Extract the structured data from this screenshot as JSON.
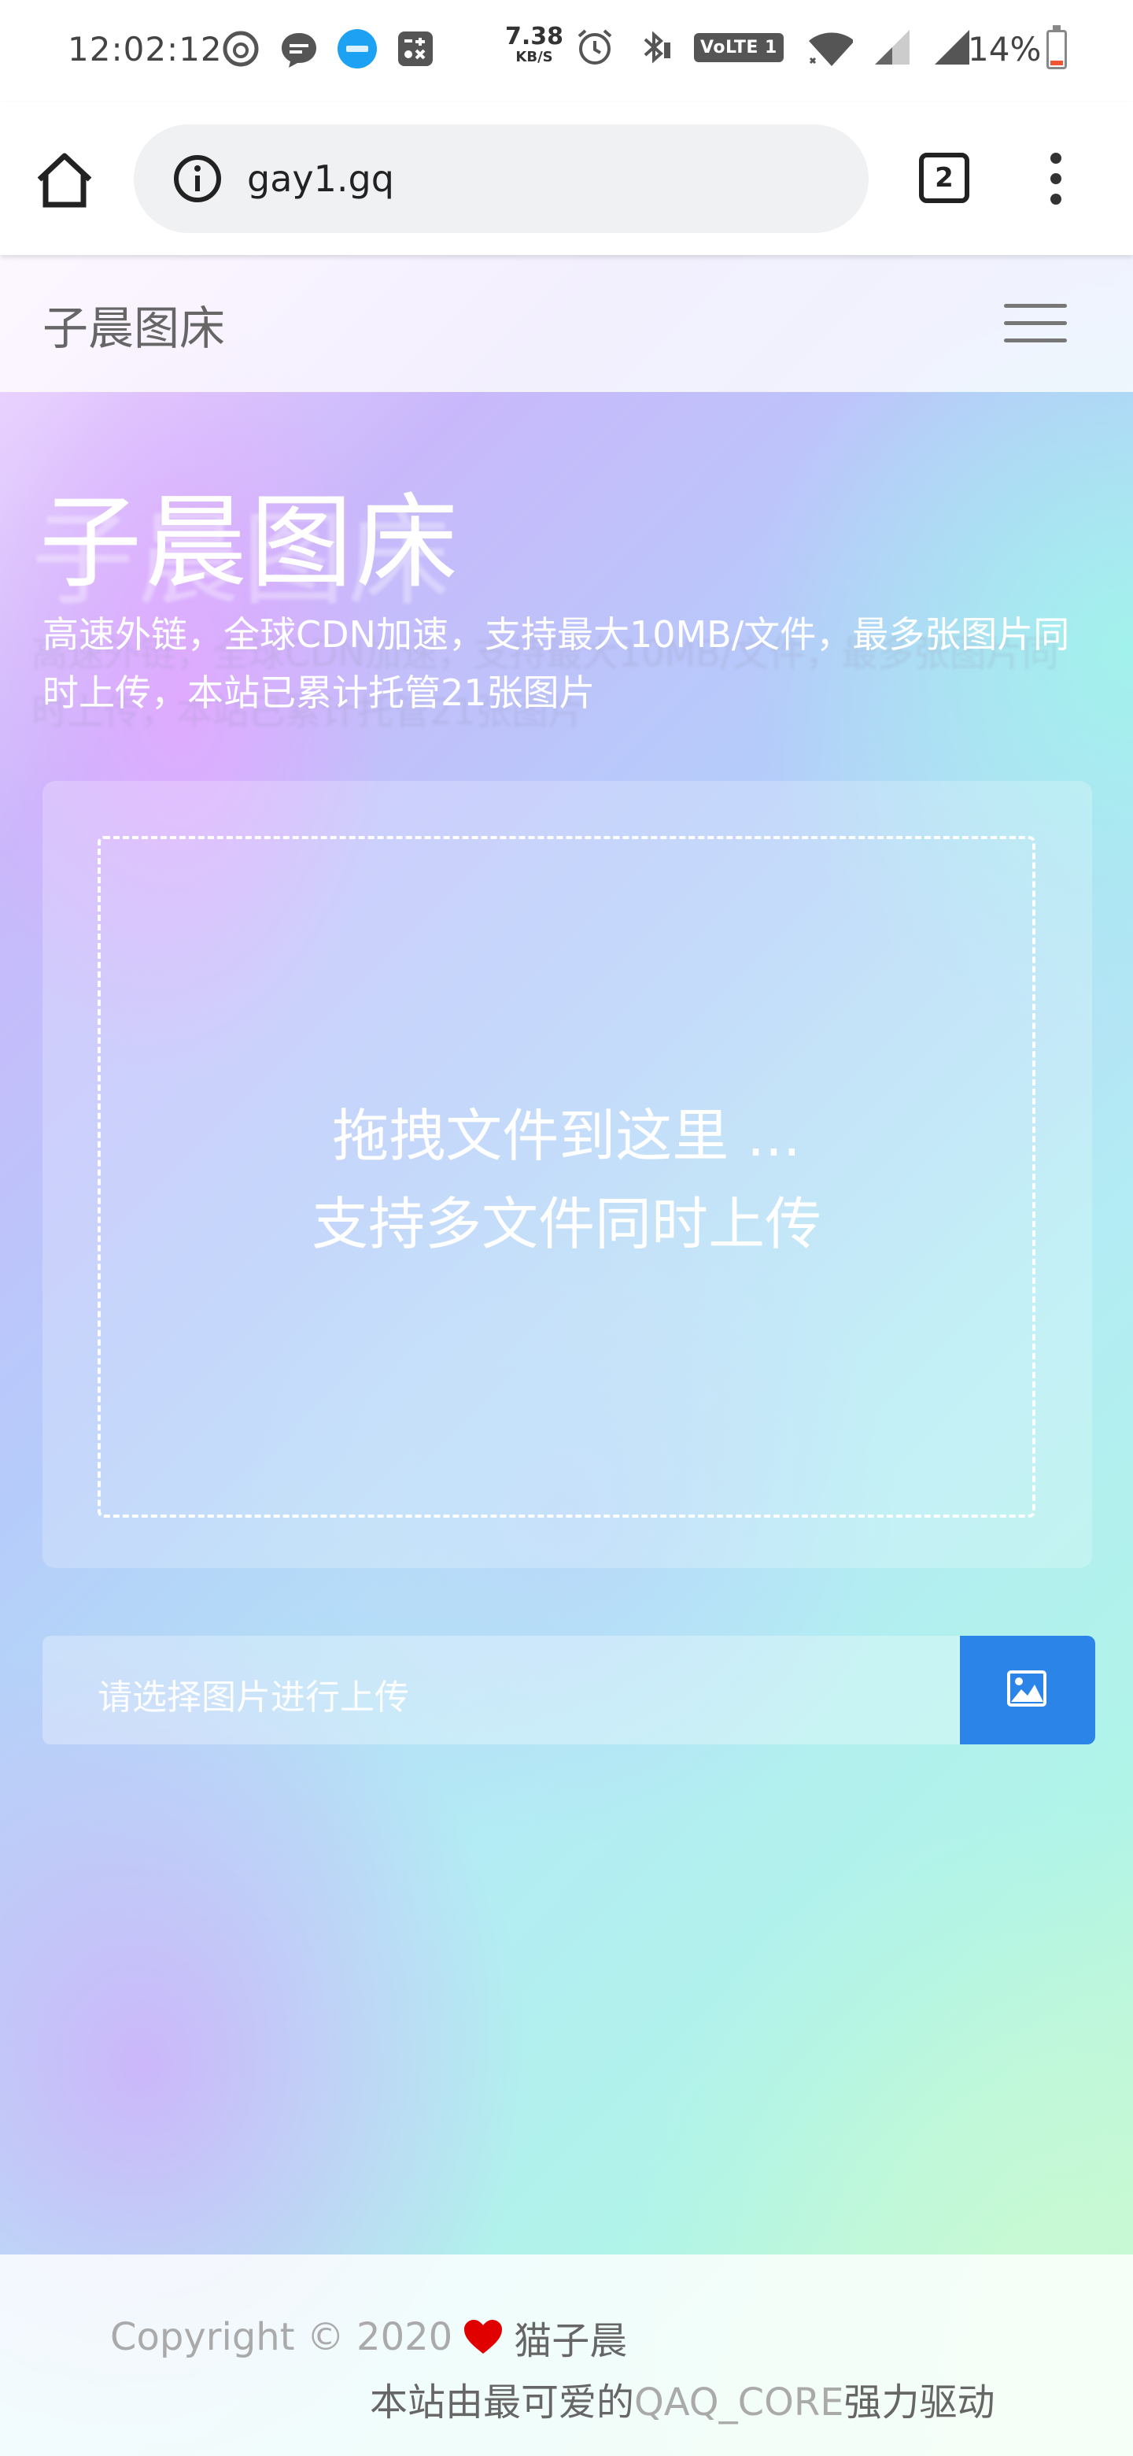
{
  "status_bar": {
    "time": "12:02:12",
    "net_speed_value": "7.38",
    "net_speed_unit": "KB/S",
    "volte_label": "VoLTE 1",
    "battery_percent": "14%",
    "battery_level": 0.14,
    "icons": [
      "netease-music-icon",
      "message-icon",
      "app-icon",
      "toolbox-icon",
      "alarm-icon",
      "bluetooth-icon",
      "wifi-icon",
      "signal-icon"
    ]
  },
  "browser": {
    "url": "gay1.gq",
    "tab_count": "2"
  },
  "navbar": {
    "brand": "子晨图床"
  },
  "hero": {
    "title": "子晨图床",
    "subtitle": "高速外链，全球CDN加速，支持最大10MB/文件，最多张图片同时上传，本站已累计托管21张图片"
  },
  "dropzone": {
    "line1": "拖拽文件到这里 ...",
    "line2": "支持多文件同时上传"
  },
  "upload": {
    "placeholder": "请选择图片进行上传",
    "button_color": "#2b84e8"
  },
  "footer": {
    "copyright": "Copyright © 2020",
    "author": "猫子晨",
    "powered_prefix": "本站由最可爱的",
    "powered_name": "QAQ_CORE",
    "powered_suffix": "强力驱动",
    "heart_color": "#e00000"
  }
}
